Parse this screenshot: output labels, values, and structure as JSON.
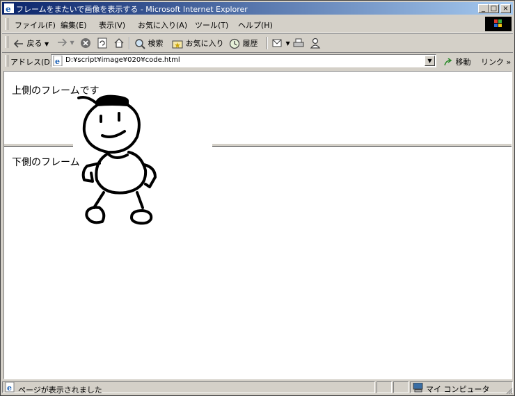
{
  "window": {
    "title": "フレームをまたいで画像を表示する - Microsoft Internet Explorer",
    "controls": [
      "_",
      "□",
      "×"
    ]
  },
  "menu": {
    "items": [
      "ファイル(F)",
      "編集(E)",
      "表示(V)",
      "お気に入り(A)",
      "ツール(T)",
      "ヘルプ(H)"
    ]
  },
  "toolbar": {
    "back": "戻る",
    "search": "検索",
    "favorites": "お気に入り",
    "history": "履歴"
  },
  "address": {
    "label": "アドレス(D)",
    "value": "D:¥script¥image¥020¥code.html",
    "go": "移動",
    "links": "リンク"
  },
  "frames": {
    "top_text": "上側のフレームです",
    "bottom_text": "下側のフレーム"
  },
  "status": {
    "text": "ページが表示されました",
    "zone": "マイ コンピュータ"
  }
}
